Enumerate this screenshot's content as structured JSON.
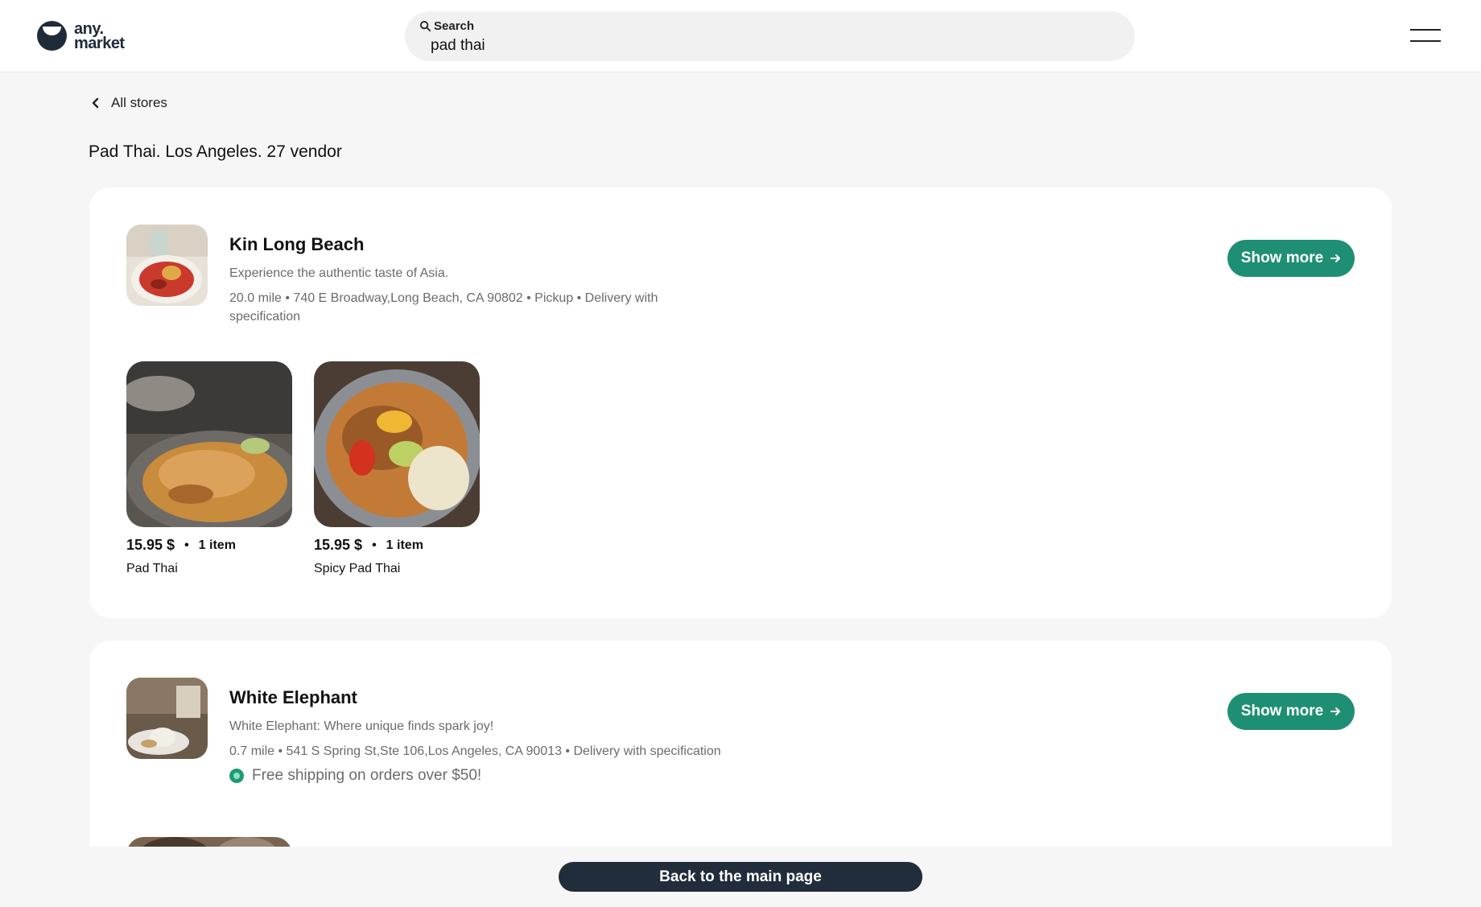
{
  "header": {
    "logo_line1": "any.",
    "logo_line2": "market",
    "search": {
      "label": "Search",
      "value": "pad thai"
    }
  },
  "nav": {
    "back_label": "All stores"
  },
  "results_title": "Pad Thai. Los Angeles. 27 vendor",
  "stores": [
    {
      "name": "Kin Long Beach",
      "description": "Experience the authentic taste of Asia.",
      "meta": "20.0 mile • 740 E Broadway,Long Beach, CA 90802 • Pickup • Delivery with specification",
      "show_more_label": "Show more",
      "products": [
        {
          "price": "15.95 $",
          "qty": "1 item",
          "name": "Pad Thai"
        },
        {
          "price": "15.95 $",
          "qty": "1 item",
          "name": "Spicy Pad Thai"
        }
      ]
    },
    {
      "name": "White Elephant",
      "description": "White Elephant: Where unique finds spark joy!",
      "meta": "0.7 mile • 541 S Spring St,Ste 106,Los Angeles, CA 90013 • Delivery with specification",
      "promo": "Free shipping on orders over $50!",
      "show_more_label": "Show more"
    }
  ],
  "footer": {
    "back_main_label": "Back to the main page"
  },
  "colors": {
    "accent": "#1f8f73",
    "dark": "#222d3b",
    "background": "#f6f6f6"
  }
}
